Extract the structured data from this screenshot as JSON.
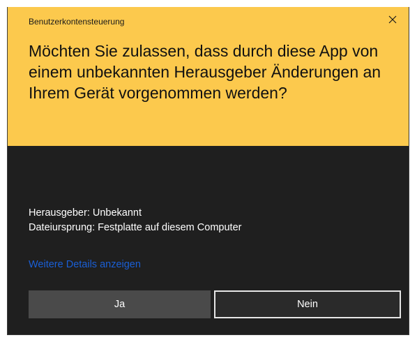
{
  "dialog": {
    "title": "Benutzerkontensteuerung",
    "question": "Möchten Sie zulassen, dass durch diese App von einem unbekannten Herausgeber Änderungen an Ihrem Gerät vorgenommen werden?",
    "publisher_line": "Herausgeber: Unbekannt",
    "origin_line": "Dateiursprung: Festplatte auf diesem Computer",
    "details_link": "Weitere Details anzeigen",
    "yes_label": "Ja",
    "no_label": "Nein",
    "close_icon": "close-icon"
  },
  "colors": {
    "header_bg": "#fcc94d",
    "body_bg": "#1f1f1f",
    "link": "#1a5fd6",
    "yes_button_bg": "#4a4a4a",
    "no_button_bg": "#2a2a2a",
    "no_button_border": "#e6e6e6"
  }
}
